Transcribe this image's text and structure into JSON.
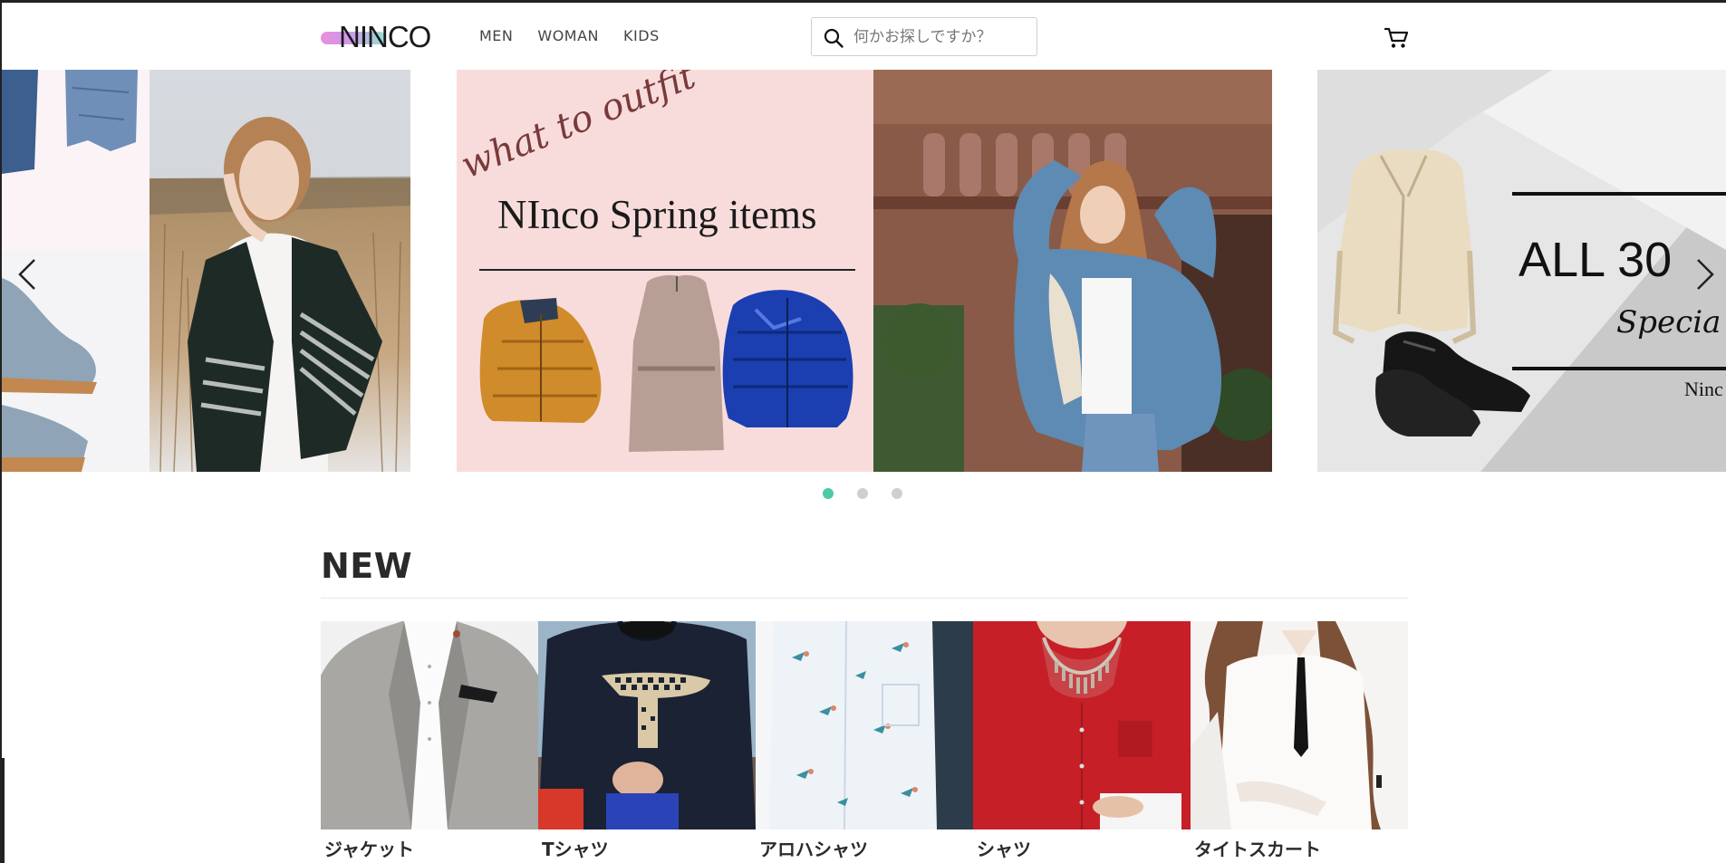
{
  "header": {
    "logo_text": "NINCO",
    "nav": [
      "MEN",
      "WOMAN",
      "KIDS"
    ],
    "search_placeholder": "何かお探しですか？"
  },
  "carousel": {
    "slide2": {
      "script_text": "what to outfit",
      "headline": "NInco Spring items"
    },
    "slide3": {
      "sale_text": "ALL 30",
      "special_text": "Specia",
      "brand_text": "Ninc"
    },
    "dots_count": 3,
    "active_dot": 0
  },
  "new_section": {
    "title": "NEW",
    "products": [
      {
        "name": "ジャケット"
      },
      {
        "name": "Tシャツ"
      },
      {
        "name": "アロハシャツ"
      },
      {
        "name": "シャツ"
      },
      {
        "name": "タイトスカート"
      }
    ]
  },
  "colors": {
    "accent": "#4ccaa6",
    "dot_inactive": "#cfcfcf",
    "text_dark": "#2a2a2a",
    "slide2_pink": "#f8dcdc"
  }
}
